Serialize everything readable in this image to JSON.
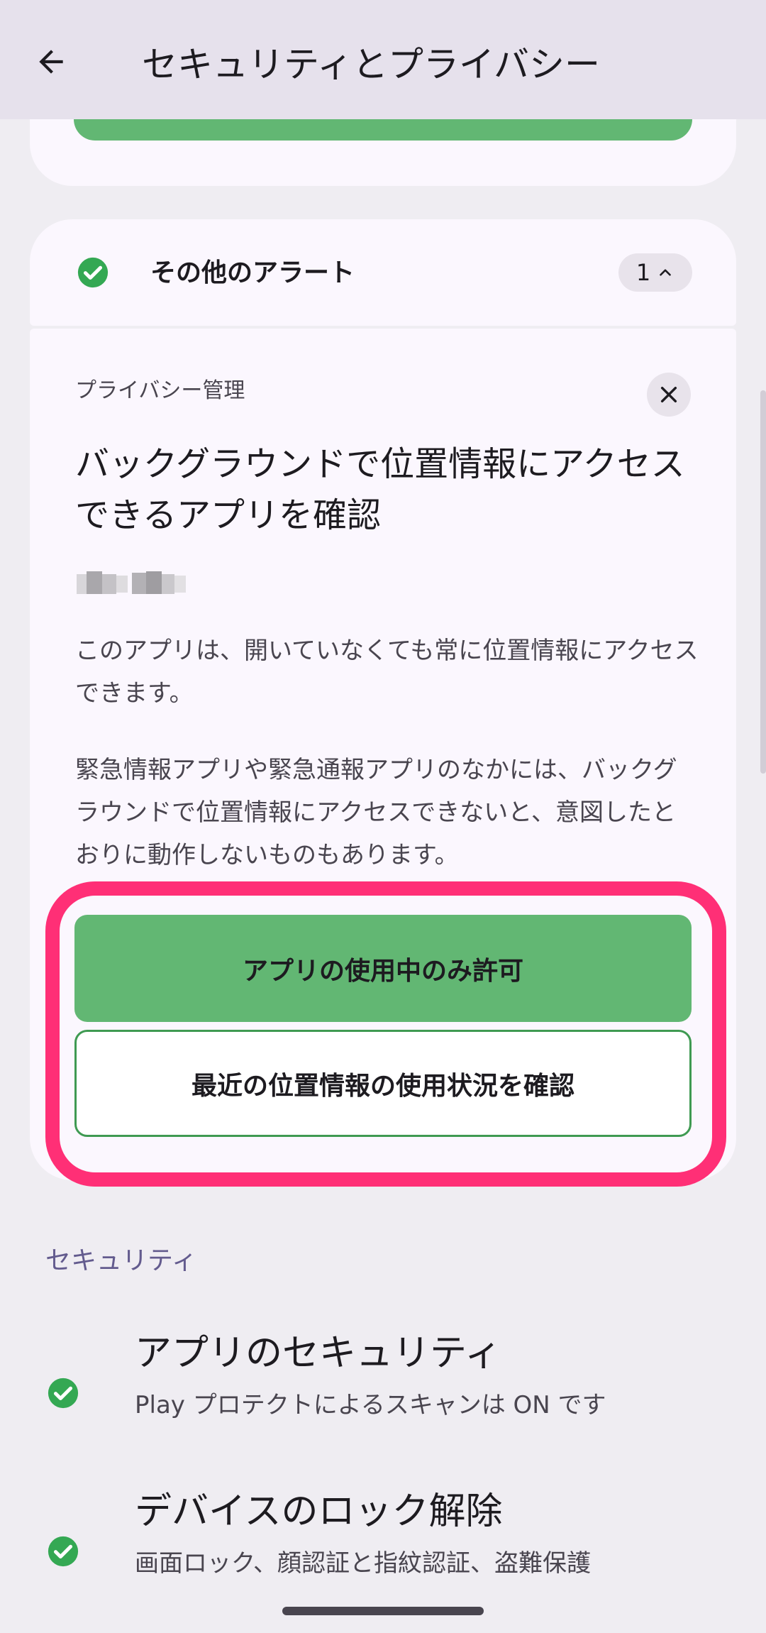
{
  "appbar": {
    "title": "セキュリティとプライバシー",
    "back_icon": "arrow-back-icon"
  },
  "alerts": {
    "header_label": "その他のアラート",
    "count": "1",
    "status_icon": "check-circle-icon",
    "status_color": "#34a853"
  },
  "alert_card": {
    "category": "プライバシー管理",
    "title": "バックグラウンドで位置情報にアクセスできるアプリを確認",
    "description_1": "このアプリは、開いていなくても常に位置情報にアクセスできます。",
    "description_2": "緊急情報アプリや緊急通報アプリのなかには、バックグラウンドで位置情報にアクセスできないと、意図したとおりに動作しないものもあります。",
    "primary_button": "アプリの使用中のみ許可",
    "secondary_button": "最近の位置情報の使用状況を確認",
    "dismiss_icon": "close-icon"
  },
  "security_section": {
    "header": "セキュリティ",
    "items": [
      {
        "title": "アプリのセキュリティ",
        "subtitle": "Play プロテクトによるスキャンは ON です",
        "icon": "check-circle-icon"
      },
      {
        "title": "デバイスのロック解除",
        "subtitle": "画面ロック、顔認証と指紋認証、盗難保護",
        "icon": "check-circle-icon"
      }
    ]
  },
  "colors": {
    "accent_green": "#62b773",
    "highlight": "#ff2f76",
    "section_header": "#635b8e",
    "background": "#efedf2",
    "card": "#fbf7fe"
  }
}
